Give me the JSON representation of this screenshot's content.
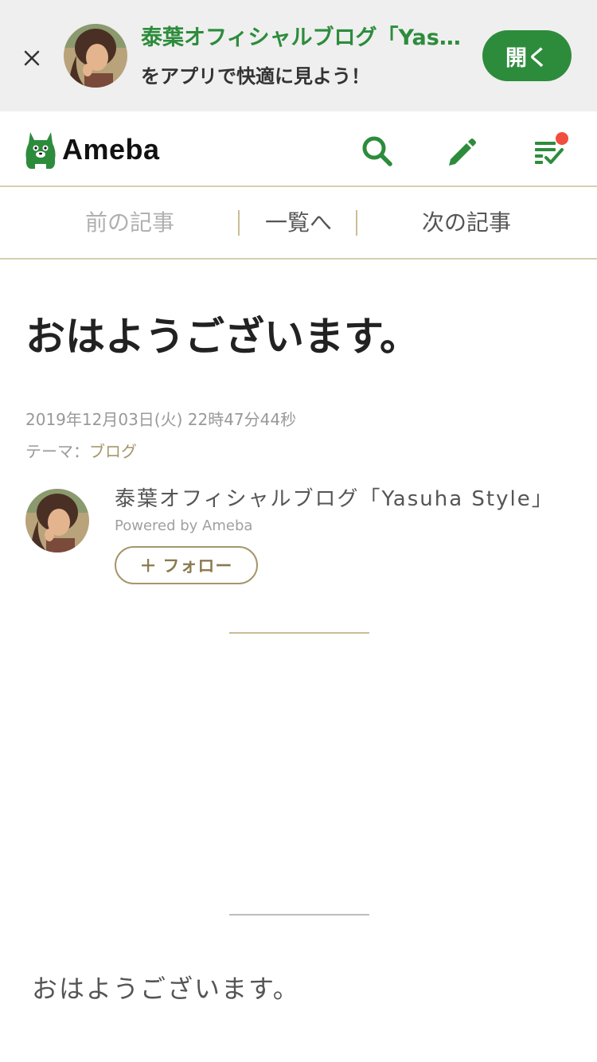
{
  "app_banner": {
    "title": "泰葉オフィシャルブログ「Yasuha Style」",
    "subtitle": "をアプリで快適に見よう！",
    "open_label": "開く"
  },
  "header": {
    "logo_text": "Ameba",
    "icons": [
      "search-icon",
      "pencil-icon",
      "reading-list-icon"
    ],
    "notification_dot": true
  },
  "pager": {
    "prev": "前の記事",
    "list": "一覧へ",
    "next": "次の記事"
  },
  "article": {
    "title": "おはようございます。",
    "date": "2019年12月03日(火) 22時47分44秒",
    "theme_label": "テーマ：",
    "theme_value": "ブログ",
    "body": "おはようございます。"
  },
  "author": {
    "name": "泰葉オフィシャルブログ「Yasuha Style」",
    "powered": "Powered by Ameba",
    "follow_label": "＋ フォロー"
  },
  "colors": {
    "brand_green": "#2d8c3c",
    "accent_gold": "#a5966a",
    "notification_red": "#f04e3e",
    "banner_bg": "#efefef"
  }
}
